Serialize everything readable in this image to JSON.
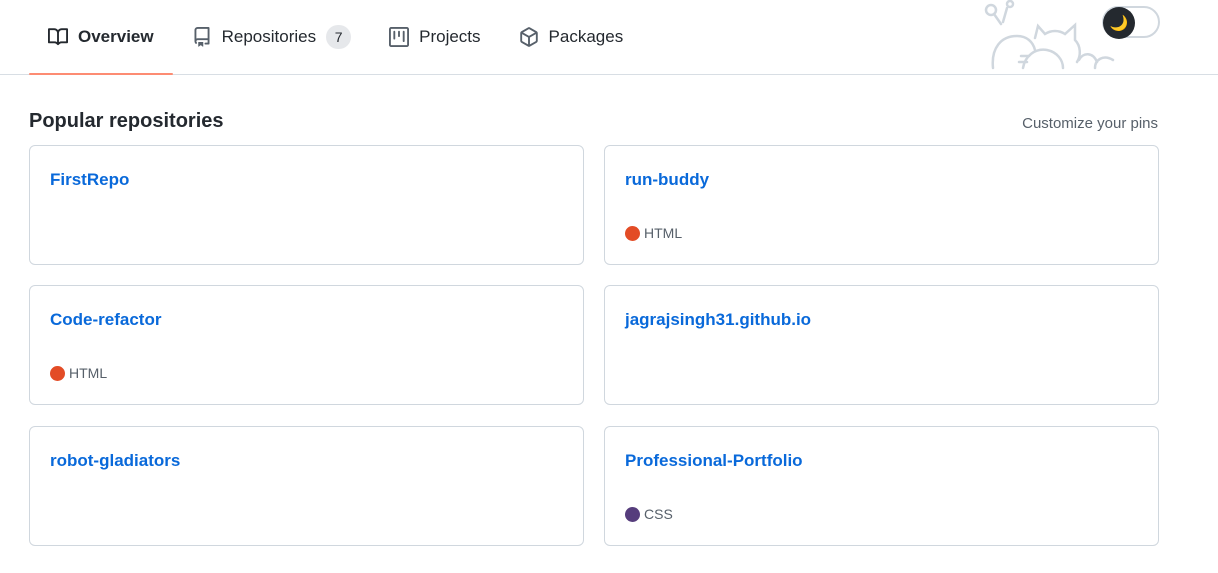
{
  "tabs": [
    {
      "label": "Overview",
      "icon": "book-icon",
      "selected": true
    },
    {
      "label": "Repositories",
      "icon": "repo-icon",
      "counter": "7"
    },
    {
      "label": "Projects",
      "icon": "project-icon"
    },
    {
      "label": "Packages",
      "icon": "package-icon"
    }
  ],
  "theme_toggle": {
    "icon": "moon-icon",
    "glyph": "🌙"
  },
  "section": {
    "title": "Popular repositories",
    "customize_label": "Customize your pins"
  },
  "repos": [
    {
      "name": "FirstRepo",
      "language": "",
      "color": ""
    },
    {
      "name": "run-buddy",
      "language": "HTML",
      "color": "#e34c26"
    },
    {
      "name": "Code-refactor",
      "language": "HTML",
      "color": "#e34c26"
    },
    {
      "name": "jagrajsingh31.github.io",
      "language": "",
      "color": ""
    },
    {
      "name": "robot-gladiators",
      "language": "",
      "color": ""
    },
    {
      "name": "Professional-Portfolio",
      "language": "CSS",
      "color": "#563d7c"
    }
  ],
  "colors": {
    "link": "#0969da",
    "tab_underline": "#fd8c73"
  }
}
